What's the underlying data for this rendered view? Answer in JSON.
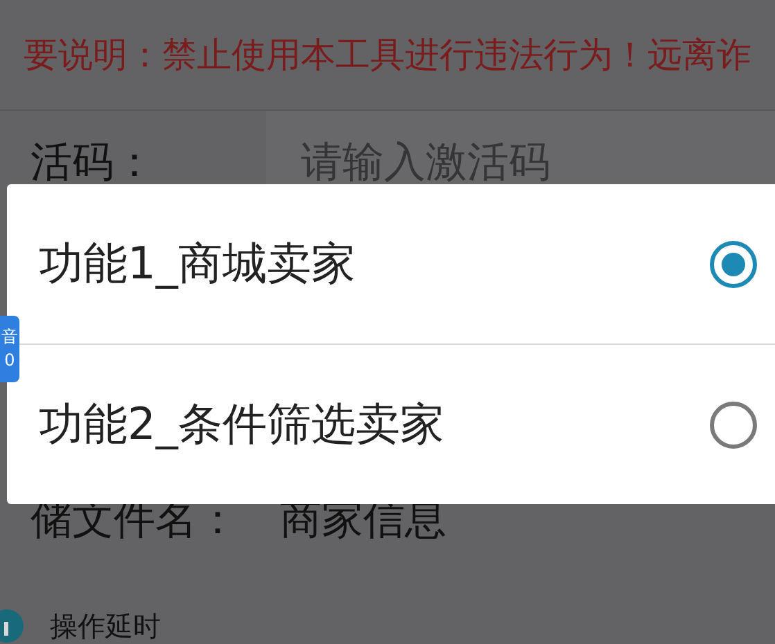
{
  "banner": {
    "text": "要说明：禁止使用本工具进行违法行为！远离诈"
  },
  "activation": {
    "label": "活码：",
    "placeholder": "请输入激活码"
  },
  "filename": {
    "label": "储文件名：",
    "value": "商家信息"
  },
  "delay": {
    "label": "操作延时"
  },
  "dialog": {
    "options": [
      {
        "label": "功能1_商城卖家",
        "selected": true
      },
      {
        "label": "功能2_条件筛选卖家",
        "selected": false
      }
    ]
  },
  "floating_badge": {
    "lines": [
      "音",
      "0"
    ]
  }
}
